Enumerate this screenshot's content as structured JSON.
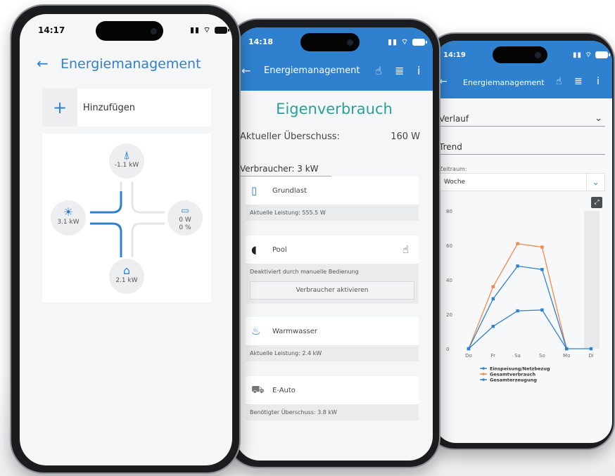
{
  "colors": {
    "accent": "#2f80cf",
    "teal_title": "#2aa198",
    "series_blue": "#2f80cf",
    "series_orange": "#f08a4b"
  },
  "phone1": {
    "time": "14:17",
    "title": "Energiemanagement",
    "add_label": "Hinzufügen",
    "flow": {
      "grid": {
        "icon": "power-pylon-icon",
        "value": "-1.1 kW"
      },
      "solar": {
        "icon": "solar-panel-icon",
        "value": "3.1 kW"
      },
      "battery": {
        "icon": "battery-icon",
        "value": "0 W",
        "percent": "0 %"
      },
      "home": {
        "icon": "house-icon",
        "value": "2.1 kW"
      }
    }
  },
  "phone2": {
    "time": "14:18",
    "title": "Energiemanagement",
    "heading": "Eigenverbrauch",
    "surplus_label": "Aktueller Überschuss:",
    "surplus_value": "160 W",
    "consumers_label": "Verbraucher: 3 kW",
    "cards": [
      {
        "icon": "fridge-icon",
        "name": "Grundlast",
        "detail": "Aktuelle Leistung: 555.5 W"
      },
      {
        "icon": "duck-icon",
        "name": "Pool",
        "detail": "Deaktiviert durch manuelle Bedienung",
        "action": "Verbraucher aktivieren"
      },
      {
        "icon": "bathtub-icon",
        "name": "Warmwasser",
        "detail": "Aktuelle Leistung: 2.4 kW"
      },
      {
        "icon": "car-icon",
        "name": "E-Auto",
        "detail": "Benötigter Überschuss: 3.8 kW"
      }
    ]
  },
  "phone3": {
    "time": "14:19",
    "title": "Energiemanagement",
    "dropdown_verlauf": "Verlauf",
    "dropdown_trend": "Trend",
    "period_label": "Zeitraum:",
    "period_value": "Woche"
  },
  "chart_data": {
    "type": "line",
    "categories": [
      "Do",
      "Fr",
      "Sa",
      "So",
      "Mo",
      "Di"
    ],
    "ylim": [
      0,
      80
    ],
    "yticks": [
      0,
      20,
      40,
      60,
      80
    ],
    "grid": false,
    "legend_position": "bottom",
    "series": [
      {
        "name": "Einspeisung/Netzbezug",
        "color": "#2f80cf",
        "values": [
          0,
          13,
          22,
          22.5,
          0,
          0
        ]
      },
      {
        "name": "Gesamtverbrauch",
        "color": "#f08a4b",
        "values": [
          0,
          36,
          61,
          59,
          0,
          null
        ]
      },
      {
        "name": "Gesamterzeugung",
        "color": "#2f80cf",
        "values": [
          0,
          29,
          48,
          46,
          0,
          null
        ]
      }
    ]
  }
}
